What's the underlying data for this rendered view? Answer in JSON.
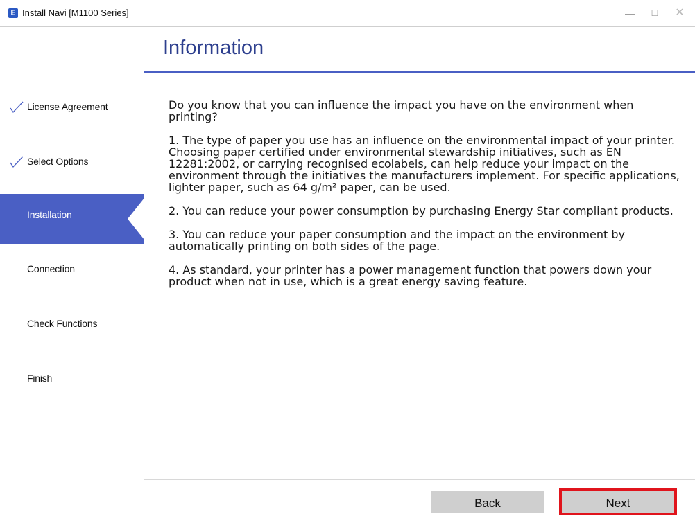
{
  "window": {
    "app_icon_letter": "E",
    "title": "Install Navi [M1100 Series]",
    "minimize_symbol": "—",
    "maximize_symbol": "☐",
    "close_symbol": "✕"
  },
  "page_title": "Information",
  "steps": [
    {
      "label": "License Agreement",
      "state": "completed",
      "icon": "checkmark-icon"
    },
    {
      "label": "Select Options",
      "state": "completed",
      "icon": "checkmark-icon"
    },
    {
      "label": "Installation",
      "state": "active"
    },
    {
      "label": "Connection",
      "state": "pending"
    },
    {
      "label": "Check Functions",
      "state": "pending"
    },
    {
      "label": "Finish",
      "state": "pending"
    }
  ],
  "content": {
    "intro": "Do you know that you can influence the impact you have on the environment when printing?",
    "points": [
      "1. The type of paper you use has an influence on the environmental impact of your printer. Choosing paper certified under environmental stewardship initiatives, such as EN 12281:2002, or carrying recognised ecolabels, can help reduce your impact on the environment through the initiatives the manufacturers implement. For specific applications, lighter paper, such as 64 g/m² paper, can be used.",
      "2. You can reduce your power consumption by purchasing Energy Star compliant products.",
      "3. You can reduce your paper consumption and the impact on the environment by automatically printing on both sides of the page.",
      "4. As standard, your printer has a power management function that powers down your product when not in use, which is a great energy saving feature."
    ]
  },
  "buttons": {
    "back": "Back",
    "next": "Next"
  },
  "colors": {
    "accent": "#4a5fc4",
    "title": "#2d3f8e",
    "highlight": "#e0141c",
    "button": "#cfcfcf"
  }
}
